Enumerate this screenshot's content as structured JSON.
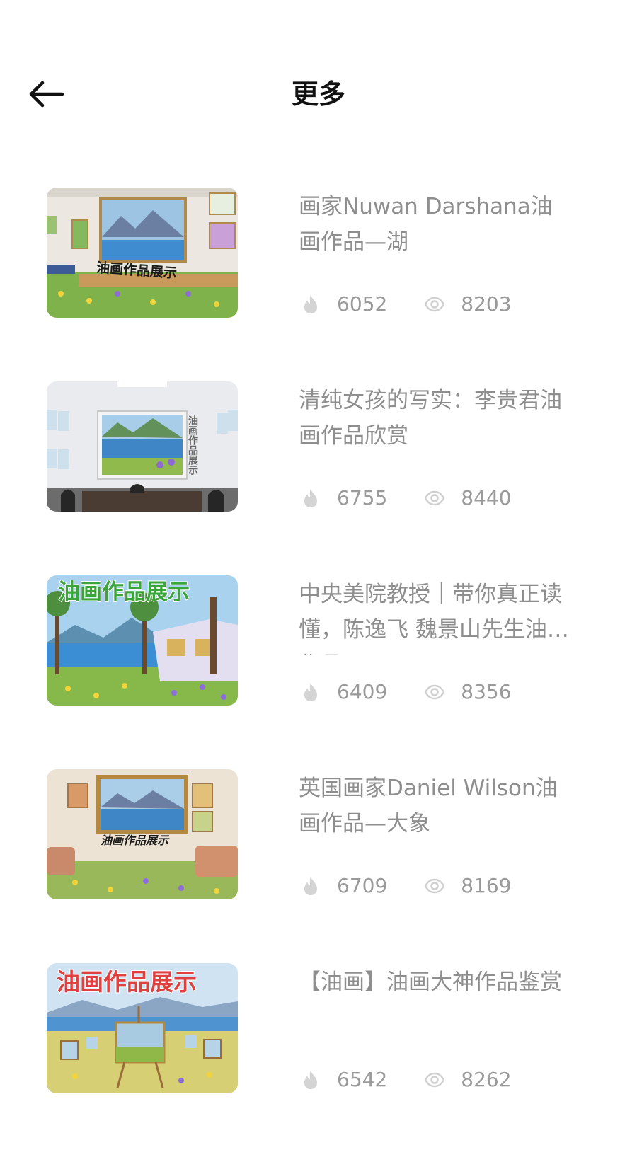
{
  "header": {
    "back_icon": "arrow-left-icon",
    "title": "更多"
  },
  "icons": {
    "likes": "flame-icon",
    "views": "eye-icon"
  },
  "items": [
    {
      "title": "画家Nuwan Darshana油画作品—湖",
      "thumbnail_text": "油画作品展示",
      "likes": "6052",
      "views": "8203"
    },
    {
      "title": "清纯女孩的写实：李贵君油画作品欣赏",
      "thumbnail_text": "油画作品展示",
      "likes": "6755",
      "views": "8440"
    },
    {
      "title": "中央美院教授｜带你真正读懂，陈逸飞 魏景山先生油画作品",
      "thumbnail_text": "油画作品展示",
      "likes": "6409",
      "views": "8356"
    },
    {
      "title": "英国画家Daniel Wilson油画作品—大象",
      "thumbnail_text": "油画作品展示",
      "likes": "6709",
      "views": "8169"
    },
    {
      "title": "【油画】油画大神作品鉴赏",
      "thumbnail_text": "油画作品展示",
      "likes": "6542",
      "views": "8262"
    }
  ]
}
